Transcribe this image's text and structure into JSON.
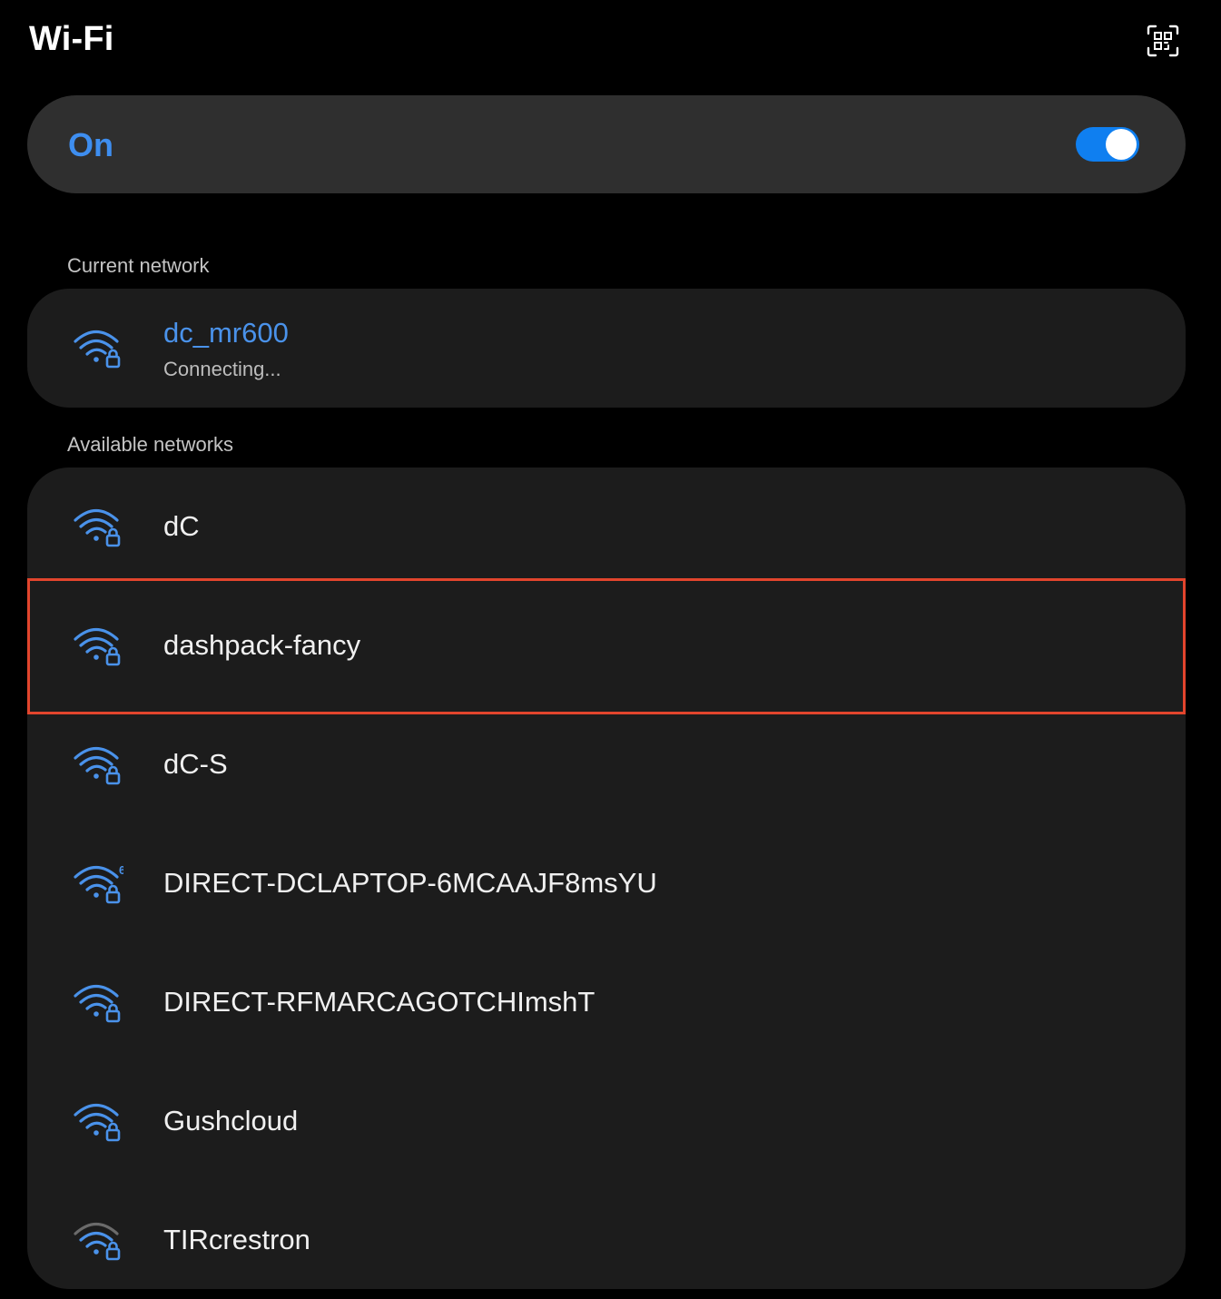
{
  "header": {
    "title": "Wi-Fi",
    "qr_icon": "qr-code-scan-icon"
  },
  "toggle": {
    "label": "On",
    "checked": true,
    "accent_color": "#0f7ff0",
    "label_color": "#3e8ef0"
  },
  "current_section": {
    "label": "Current network",
    "network": {
      "name": "dc_mr600",
      "status": "Connecting...",
      "icon": "wifi-lock-icon"
    }
  },
  "available_section": {
    "label": "Available networks",
    "networks": [
      {
        "name": "dC",
        "icon": "wifi-lock-icon",
        "signal": "strong"
      },
      {
        "name": "dashpack-fancy",
        "icon": "wifi-lock-icon",
        "signal": "strong",
        "highlighted": true
      },
      {
        "name": "dC-S",
        "icon": "wifi-lock-icon",
        "signal": "strong"
      },
      {
        "name": "DIRECT-DCLAPTOP-6MCAAJF8msYU",
        "icon": "wifi6-lock-icon",
        "signal": "strong",
        "badge": "6"
      },
      {
        "name": "DIRECT-RFMARCAGOTCHImshT",
        "icon": "wifi-lock-icon",
        "signal": "strong"
      },
      {
        "name": "Gushcloud",
        "icon": "wifi-lock-icon",
        "signal": "strong"
      },
      {
        "name": "TIRcrestron",
        "icon": "wifi-lock-icon",
        "signal": "weak"
      }
    ]
  },
  "colors": {
    "icon_blue": "#4a92ea",
    "icon_dim": "#6b6b6b",
    "highlight_border": "#e2452d"
  }
}
